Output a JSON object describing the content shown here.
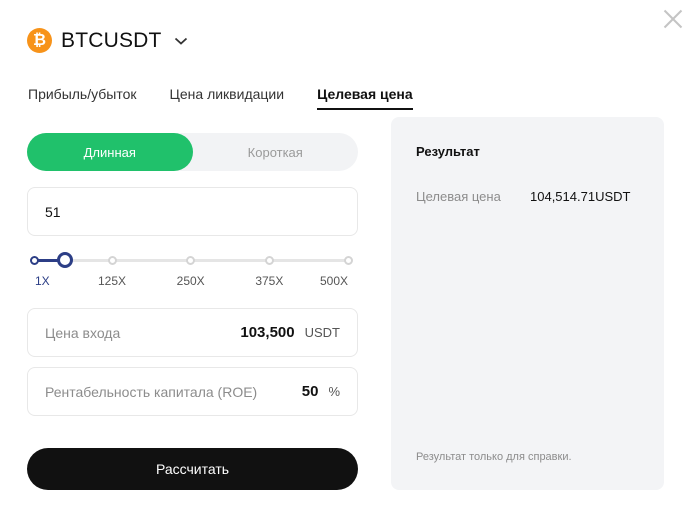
{
  "header": {
    "symbol": "BTCUSDT",
    "coin_glyph": "₿",
    "coin_icon": "bitcoin-icon",
    "coin_color": "#f7931a",
    "dropdown_icon": "chevron-down-icon",
    "close_icon": "close-icon"
  },
  "tabs": [
    {
      "label": "Прибыль/убыток",
      "active": false
    },
    {
      "label": "Цена ликвидации",
      "active": false
    },
    {
      "label": "Целевая цена",
      "active": true
    }
  ],
  "side": {
    "long_label": "Длинная",
    "short_label": "Короткая",
    "selected": "long",
    "long_color": "#20c16b"
  },
  "leverage": {
    "value": "51",
    "slider_value": 51,
    "min": 1,
    "max": 500,
    "ticks": [
      "1X",
      "125X",
      "250X",
      "375X",
      "500X"
    ],
    "accent_color": "#2c3e86"
  },
  "entry_price": {
    "label": "Цена входа",
    "value": "103,500",
    "unit": "USDT"
  },
  "roe": {
    "label": "Рентабельность капитала (ROE)",
    "value": "50",
    "unit": "%"
  },
  "calculate_label": "Рассчитать",
  "result": {
    "title": "Результат",
    "row_label": "Целевая цена",
    "row_value": "104,514.71USDT",
    "note": "Результат только для справки."
  }
}
